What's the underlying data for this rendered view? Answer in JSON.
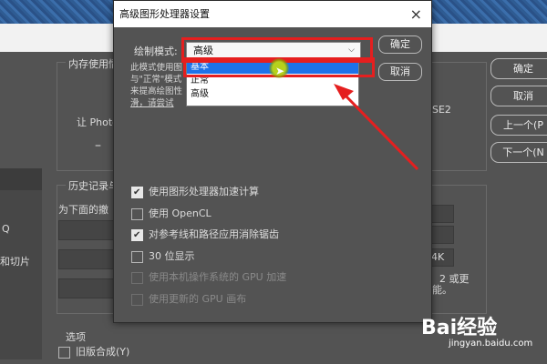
{
  "dialog": {
    "title": "高级图形处理器设置",
    "close": "×",
    "mode_label": "绘制模式:",
    "mode_value": "高级",
    "options": [
      "基本",
      "正常",
      "高级"
    ],
    "desc_lines": [
      "此模式使用图",
      "与\"正常\"模式",
      "来提高绘图性",
      "滑，请尝试"
    ],
    "ok": "确定",
    "cancel": "取消",
    "checks": [
      {
        "label": "使用图形处理器加速计算",
        "checked": true,
        "enabled": true
      },
      {
        "label": "使用 OpenCL",
        "checked": false,
        "enabled": true
      },
      {
        "label": "对参考线和路径应用消除锯齿",
        "checked": true,
        "enabled": true
      },
      {
        "label": "30 位显示",
        "checked": false,
        "enabled": true
      },
      {
        "label": "使用本机操作系统的 GPU 加速",
        "checked": false,
        "enabled": false
      },
      {
        "label": "使用更新的 GPU 画布",
        "checked": false,
        "enabled": false
      }
    ]
  },
  "background": {
    "memory_group": "内存使用情",
    "let_text": "让 Photo",
    "dash": "–",
    "history_group": "历史记录与",
    "history_desc": "为下面的撤",
    "options_group": "选项",
    "legacy": "旧版合成(Y)",
    "left_items": [
      "Q",
      "和切片"
    ],
    "se2": "SE2",
    "r4k": "4K",
    "or_more": "2 或更",
    "dot": "能。",
    "buttons": [
      "确定",
      "取消",
      "上一个(P",
      "下一个(N"
    ]
  },
  "watermark": {
    "logo": "Bai经验",
    "url": "jingyan.baidu.com"
  },
  "colors": {
    "accent": "#1e72e8",
    "highlight": "#e51f1f"
  }
}
